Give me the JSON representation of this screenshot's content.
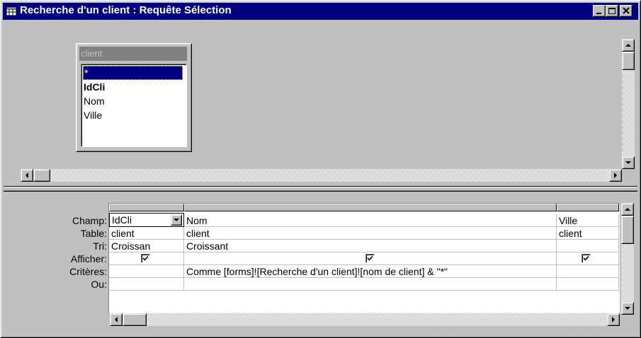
{
  "window": {
    "title": "Recherche d'un client : Requête Sélection"
  },
  "field_list": {
    "table_name": "client",
    "fields": [
      "*",
      "IdCli",
      "Nom",
      "Ville"
    ],
    "selected_index": 0
  },
  "grid": {
    "row_labels": [
      "Champ:",
      "Table:",
      "Tri:",
      "Afficher:",
      "Critères:",
      "Ou:"
    ],
    "columns": [
      {
        "champ": "IdCli",
        "table": "client",
        "tri": "Croissan",
        "afficher": true,
        "criteres": "",
        "ou": ""
      },
      {
        "champ": "Nom",
        "table": "client",
        "tri": "Croissant",
        "afficher": true,
        "criteres": "Comme [forms]![Recherche d'un client]![nom de client] & \"*\"",
        "ou": ""
      },
      {
        "champ": "Ville",
        "table": "client",
        "tri": "",
        "afficher": true,
        "criteres": "",
        "ou": ""
      }
    ]
  },
  "icons": {
    "title": "query-datasheet-icon",
    "minimize": "minimize-icon",
    "maximize": "maximize-icon",
    "close": "close-icon"
  },
  "colors": {
    "titlebar": "#000080",
    "face": "#c0c0c0",
    "highlight": "#000080"
  }
}
